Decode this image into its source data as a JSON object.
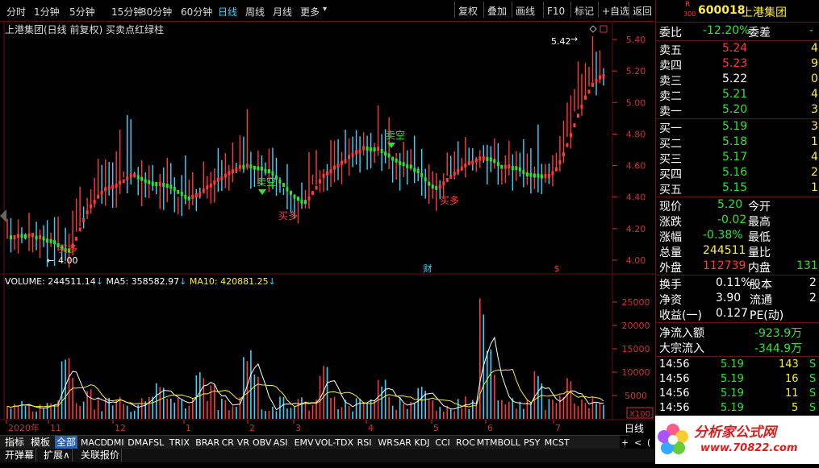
{
  "toolbar": {
    "periods": [
      "分时",
      "1分钟",
      "5分钟",
      "15分钟",
      "30分钟",
      "60分钟",
      "日线",
      "周线",
      "月线",
      "更多"
    ],
    "active_period": "日线",
    "more_arrow": "▾",
    "buttons": [
      "复权",
      "叠加",
      "画线",
      "F10",
      "标记",
      "+自选",
      "返回"
    ]
  },
  "chart": {
    "title": "上港集团(日线 前复权) 买卖点红绿柱",
    "price_axis": [
      "5.40",
      "5.20",
      "5.00",
      "4.80",
      "4.60",
      "4.40",
      "4.20",
      "4.00"
    ],
    "high_label": "5.42",
    "low_label": "4.00",
    "signals": [
      {
        "label": "卖空",
        "color": "#2ee52e",
        "type": "sell"
      },
      {
        "label": "买多",
        "color": "#ff3a3a",
        "type": "buy"
      },
      {
        "label": "卖空",
        "color": "#2ee52e",
        "type": "sell"
      },
      {
        "label": "买多",
        "color": "#ff3a3a",
        "type": "buy"
      },
      {
        "label": "买多",
        "color": "#ff3a3a",
        "type": "buy"
      }
    ],
    "events": [
      "财",
      "$"
    ],
    "volume_header": {
      "volume": "VOLUME: 244511.14",
      "ma5": "MA5: 358582.97",
      "ma10": "MA10: 420881.25"
    },
    "volume_axis": [
      "25000",
      "20000",
      "15000",
      "10000",
      "5000"
    ],
    "volume_unit": "X100",
    "date_axis": [
      "2020年",
      "11",
      "12",
      "1",
      "2",
      "3",
      "4",
      "5",
      "6",
      "7"
    ],
    "period_label": "日线",
    "colors": {
      "up": "#ff3a3a",
      "down": "#37d5ff",
      "ma5": "#ffffff",
      "ma10": "#ffee33",
      "bg": "#000000",
      "border": "#6a1010"
    }
  },
  "quote": {
    "code": "600018",
    "name": "上港集团",
    "badge_r": "R",
    "badge_num": "300",
    "weibi_label": "委比",
    "weibi_value": "-12.20%",
    "weicha_label": "委差",
    "weicha_value": "-",
    "asks": [
      {
        "label": "卖五",
        "price": "5.24",
        "vol": "4"
      },
      {
        "label": "卖四",
        "price": "5.23",
        "vol": "9"
      },
      {
        "label": "卖三",
        "price": "5.22",
        "vol": "0"
      },
      {
        "label": "卖二",
        "price": "5.21",
        "vol": "4"
      },
      {
        "label": "卖一",
        "price": "5.20",
        "vol": "3"
      }
    ],
    "bids": [
      {
        "label": "买一",
        "price": "5.19",
        "vol": "3"
      },
      {
        "label": "买二",
        "price": "5.18",
        "vol": "1"
      },
      {
        "label": "买三",
        "price": "5.17",
        "vol": "4"
      },
      {
        "label": "买四",
        "price": "5.16",
        "vol": "2"
      },
      {
        "label": "买五",
        "price": "5.15",
        "vol": "1"
      }
    ],
    "stats_left": [
      {
        "label": "现价",
        "value": "5.20",
        "color": "green"
      },
      {
        "label": "涨跌",
        "value": "-0.02",
        "color": "green"
      },
      {
        "label": "涨幅",
        "value": "-0.38%",
        "color": "green"
      },
      {
        "label": "总量",
        "value": "244511",
        "color": "yellow"
      },
      {
        "label": "外盘",
        "value": "112739",
        "color": "red"
      }
    ],
    "stats_right": [
      "今开",
      "最高",
      "最低",
      "量比",
      "内盘"
    ],
    "neipan_value": "131",
    "info": [
      {
        "label": "换手",
        "value": "0.11%",
        "right": "股本",
        "rv": "2"
      },
      {
        "label": "净资",
        "value": "3.90",
        "right": "流通",
        "rv": "2"
      },
      {
        "label": "收益(一)",
        "value": "0.127",
        "right": "PE(动)",
        "rv": ""
      }
    ],
    "flow": [
      {
        "label": "净流入额",
        "value": "-923.9万"
      },
      {
        "label": "大宗流入",
        "value": "-344.9万"
      }
    ],
    "ticks": [
      {
        "time": "14:56",
        "price": "5.19",
        "vol": "143",
        "bs": "S"
      },
      {
        "time": "14:56",
        "price": "5.19",
        "vol": "16",
        "bs": "S"
      },
      {
        "time": "14:56",
        "price": "5.19",
        "vol": "11",
        "bs": "S"
      },
      {
        "time": "14:56",
        "price": "5.19",
        "vol": "5",
        "bs": "S"
      }
    ]
  },
  "indicator_tabs": [
    "指标",
    "模板",
    "全部",
    "MACD",
    "DMI",
    "DMA",
    "FSL",
    "TRIX",
    "BRAR",
    "CR",
    "VR",
    "OBV",
    "ASI",
    "EMV",
    "VOL-TDX",
    "RSI",
    "WR",
    "SAR",
    "KDJ",
    "CCI",
    "ROC",
    "MTM",
    "BOLL",
    "PSY",
    "MCST"
  ],
  "active_indicator_tab": "全部",
  "scroll_buttons": [
    "+",
    "<",
    "("
  ],
  "bottom_tabs": [
    "开弹幕",
    "扩展∧",
    "关联报价"
  ],
  "watermark": {
    "title": "分析家公式网",
    "url": "www.70822.com"
  }
}
